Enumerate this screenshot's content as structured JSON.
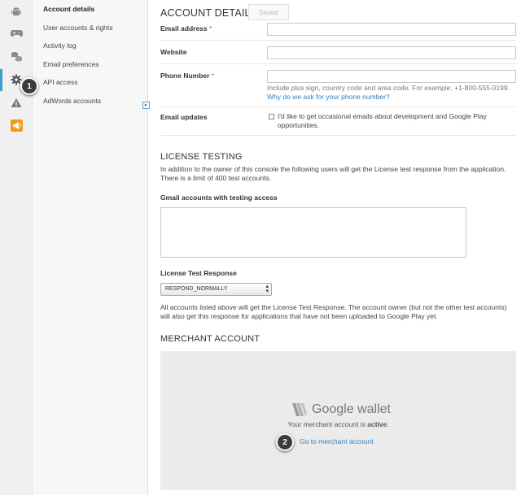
{
  "rail": {
    "icons": [
      "android-icon",
      "gamepad-icon",
      "coins-icon",
      "gear-icon",
      "warning-icon",
      "megaphone-icon"
    ],
    "active_color": "#3aa0c9",
    "promo_color": "#f39c12"
  },
  "nav": {
    "items": [
      "Account details",
      "User accounts & rights",
      "Activity log",
      "Email preferences",
      "API access",
      "AdWords accounts"
    ],
    "ad_badge": "▸"
  },
  "callouts": {
    "one": "1",
    "two": "2"
  },
  "header": {
    "title": "ACCOUNT DETAILS",
    "saved_button": "Saved"
  },
  "form": {
    "email_label": "Email address",
    "website_label": "Website",
    "phone_label": "Phone Number",
    "required_mark": "*",
    "phone_help": "Include plus sign, country code and area code. For example, +1-800-555-0199.",
    "phone_link": "Why do we ask for your phone number?",
    "email_updates_label": "Email updates",
    "email_updates_text": "I'd like to get occasional emails about development and Google Play opportunities."
  },
  "license": {
    "heading": "LICENSE TESTING",
    "intro": "In addition to the owner of this console the following users will get the License test response from the application. There is a limit of 400 test accounts.",
    "gmail_label": "Gmail accounts with testing access",
    "response_label": "License Test Response",
    "response_value": "RESPOND_NORMALLY",
    "note": "All accounts listed above will get the License Test Response. The account owner (but not the other test accounts) will also get this response for applications that have not been uploaded to Google Play yet."
  },
  "merchant": {
    "heading": "MERCHANT ACCOUNT",
    "logo_text": "Google wallet",
    "status_prefix": "Your merchant account is ",
    "status_value": "active",
    "status_suffix": ".",
    "link": "Go to merchant account"
  }
}
